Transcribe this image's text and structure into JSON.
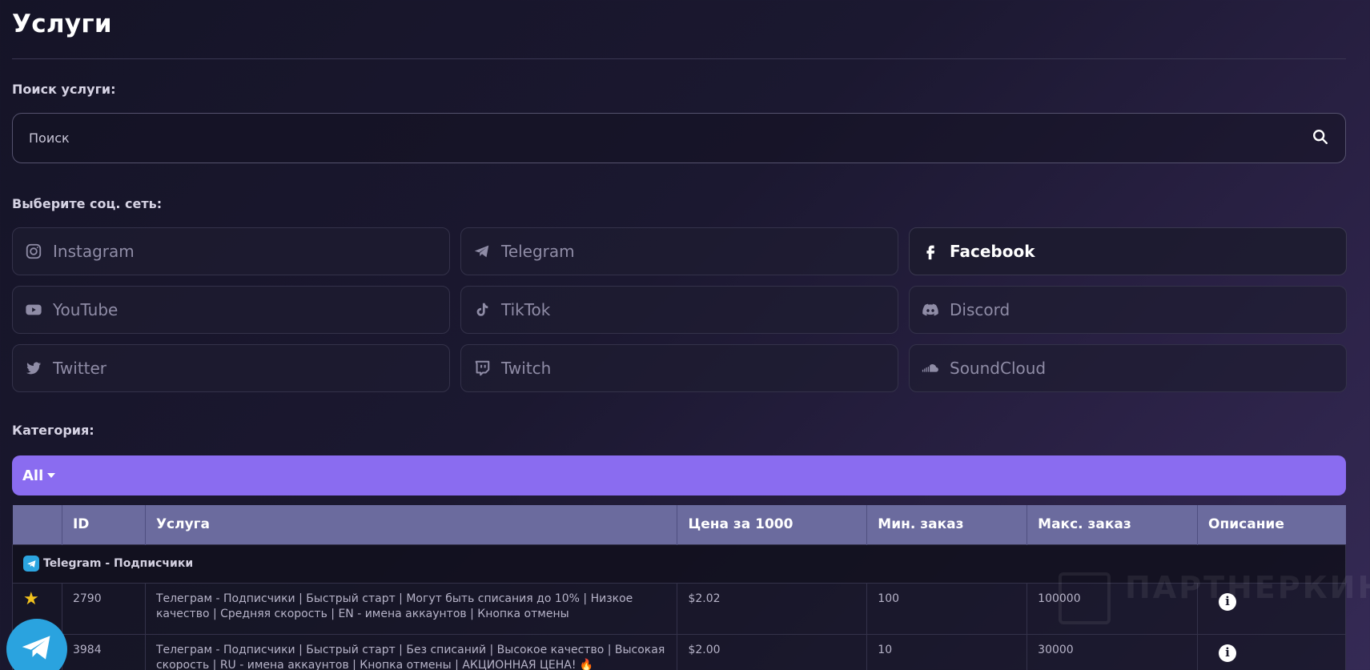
{
  "page": {
    "title": "Услуги"
  },
  "search": {
    "label": "Поиск услуги:",
    "placeholder": "Поиск",
    "value": ""
  },
  "social": {
    "label": "Выберите соц. сеть:",
    "items": [
      {
        "label": "Instagram",
        "icon": "instagram-icon",
        "active": false
      },
      {
        "label": "Telegram",
        "icon": "telegram-icon",
        "active": false
      },
      {
        "label": "Facebook",
        "icon": "facebook-icon",
        "active": true
      },
      {
        "label": "YouTube",
        "icon": "youtube-icon",
        "active": false
      },
      {
        "label": "TikTok",
        "icon": "tiktok-icon",
        "active": false
      },
      {
        "label": "Discord",
        "icon": "discord-icon",
        "active": false
      },
      {
        "label": "Twitter",
        "icon": "twitter-icon",
        "active": false
      },
      {
        "label": "Twitch",
        "icon": "twitch-icon",
        "active": false
      },
      {
        "label": "SoundCloud",
        "icon": "soundcloud-icon",
        "active": false
      }
    ]
  },
  "category": {
    "label": "Категория:",
    "selected": "All"
  },
  "table": {
    "headers": [
      "",
      "ID",
      "Услуга",
      "Цена за 1000",
      "Мин. заказ",
      "Макс. заказ",
      "Описание"
    ],
    "group": "Telegram - Подписчики",
    "rows": [
      {
        "id": "2790",
        "service": "Телеграм - Подписчики | Быстрый старт | Могут быть списания до 10% | Низкое качество | Средняя скорость | EN - имена аккаунтов | Кнопка отмены",
        "price": "$2.02",
        "min": "100",
        "max": "100000",
        "favorite": true
      },
      {
        "id": "3984",
        "service": "Телеграм - Подписчики | Быстрый старт | Без списаний | Высокое качество | Высокая скорость | RU - имена аккаунтов | Кнопка отмены | АКЦИОННАЯ ЦЕНА! 🔥",
        "price": "$2.00",
        "min": "10",
        "max": "30000",
        "favorite": false
      }
    ]
  },
  "watermark": "ПАРТНЕРКИН",
  "colors": {
    "accent": "#8a6cf0",
    "table_header": "#6b6b9e",
    "telegram": "#2aa3df",
    "star": "#f2c21d"
  }
}
